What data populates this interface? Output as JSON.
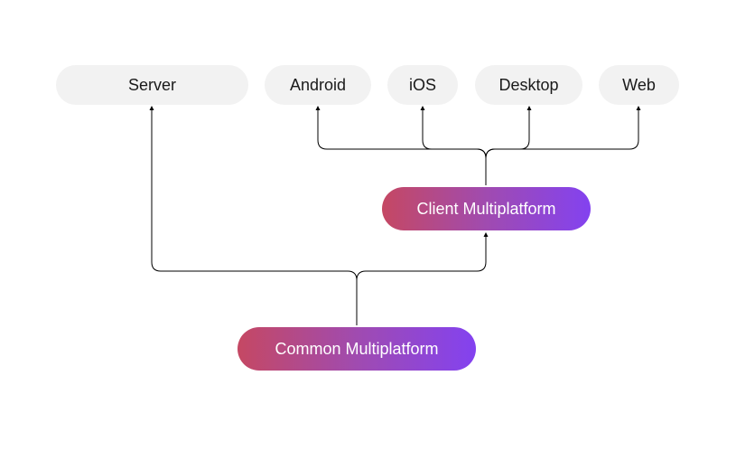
{
  "diagram": {
    "targets": {
      "server": "Server",
      "android": "Android",
      "ios": "iOS",
      "desktop": "Desktop",
      "web": "Web"
    },
    "client": "Client Multiplatform",
    "common": "Common Multiplatform"
  },
  "colors": {
    "leafBg": "#f2f2f2",
    "leafText": "#1a1a1a",
    "gradientFrom": "#c54863",
    "gradientMid": "#a04bb0",
    "gradientTo": "#8342f0",
    "connector": "#000000"
  }
}
